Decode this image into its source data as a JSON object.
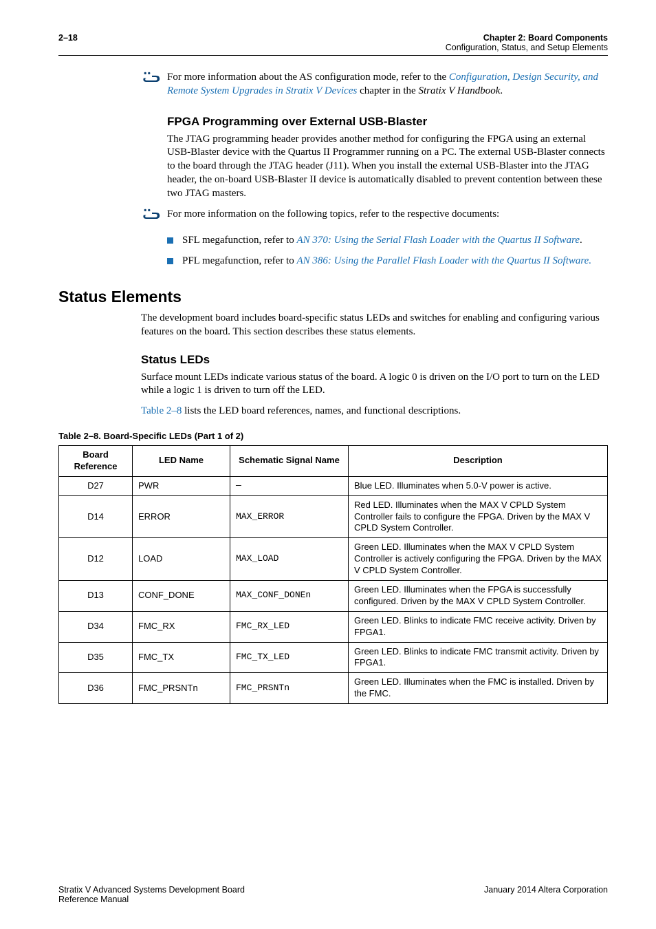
{
  "header": {
    "page_num": "2–18",
    "chapter": "Chapter 2: Board Components",
    "section": "Configuration, Status, and Setup Elements"
  },
  "ref1": {
    "pre": "For more information about the AS configuration mode, refer to the ",
    "link1": "Configuration, Design Security, and Remote System Upgrades in Stratix V Devices",
    "mid": " chapter in the ",
    "ital": "Stratix V Handbook",
    "end": "."
  },
  "h3_fpga": "FPGA Programming over External USB-Blaster",
  "p_fpga": "The JTAG programming header provides another method for configuring the FPGA using an external USB-Blaster device with the Quartus II Programmer running on a PC. The external USB-Blaster connects to the board through the JTAG header (J11). When you install the external USB-Blaster into the JTAG header, the on-board USB-Blaster II device is automatically disabled to prevent contention between these two JTAG masters.",
  "ref2": "For more information on the following topics, refer to the respective documents:",
  "bullets": [
    {
      "pre": "SFL megafunction, refer to ",
      "link": "AN 370: Using the Serial Flash Loader with the Quartus II Software",
      "post": "."
    },
    {
      "pre": "PFL megafunction, refer to ",
      "link": "AN 386: Using the Parallel Flash Loader with the Quartus II Software.",
      "post": ""
    }
  ],
  "h2_status": "Status Elements",
  "p_status": "The development board includes board-specific status LEDs and switches for enabling and configuring various features on the board. This section describes these status elements.",
  "h3_leds": "Status LEDs",
  "p_leds": "Surface mount LEDs indicate various status of the board. A logic 0 is driven on the I/O port to turn on the LED while a logic 1 is driven to turn off the LED.",
  "p_table_ref_pre": "",
  "p_table_ref_link": "Table 2–8",
  "p_table_ref_post": " lists the LED board references, names, and functional descriptions.",
  "table": {
    "caption": "Table 2–8.  Board-Specific LEDs  (Part 1 of 2)",
    "headers": [
      "Board Reference",
      "LED Name",
      "Schematic Signal Name",
      "Description"
    ],
    "rows": [
      {
        "ref": "D27",
        "name": "PWR",
        "sig": "—",
        "desc": "Blue LED. Illuminates when 5.0-V power is active."
      },
      {
        "ref": "D14",
        "name": "ERROR",
        "sig": "MAX_ERROR",
        "desc": "Red LED. Illuminates when the MAX V CPLD System Controller fails to configure the FPGA. Driven by the MAX V CPLD System Controller."
      },
      {
        "ref": "D12",
        "name": "LOAD",
        "sig": "MAX_LOAD",
        "desc": "Green LED. Illuminates when the MAX V CPLD System Controller is actively configuring the FPGA. Driven by the MAX V CPLD System Controller."
      },
      {
        "ref": "D13",
        "name": "CONF_DONE",
        "sig": "MAX_CONF_DONEn",
        "desc": "Green LED. Illuminates when the FPGA is successfully configured. Driven by the MAX V CPLD System Controller."
      },
      {
        "ref": "D34",
        "name": "FMC_RX",
        "sig": "FMC_RX_LED",
        "desc": "Green LED. Blinks to indicate FMC receive activity. Driven by FPGA1."
      },
      {
        "ref": "D35",
        "name": "FMC_TX",
        "sig": "FMC_TX_LED",
        "desc": "Green LED. Blinks to indicate FMC transmit activity. Driven by FPGA1."
      },
      {
        "ref": "D36",
        "name": "FMC_PRSNTn",
        "sig": "FMC_PRSNTn",
        "desc": "Green LED. Illuminates when the FMC is installed. Driven by the FMC."
      }
    ]
  },
  "footer": {
    "left1": "Stratix V Advanced Systems Development Board",
    "left2": "Reference Manual",
    "right": "January 2014   Altera Corporation"
  }
}
